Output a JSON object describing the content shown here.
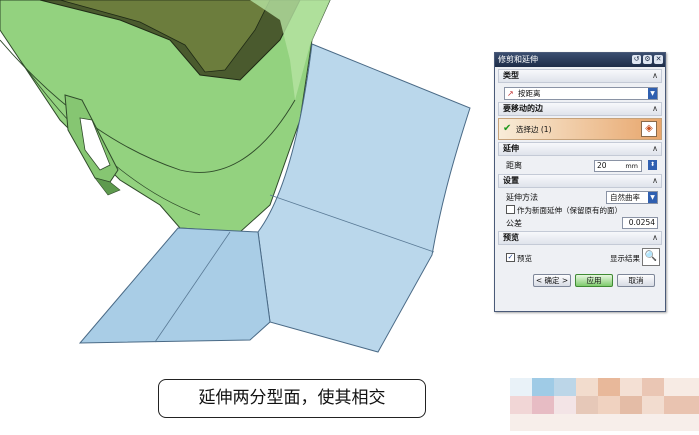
{
  "dialog": {
    "title": "修剪和延伸",
    "title_icons": [
      "rotate-icon",
      "gear-icon",
      "close-icon"
    ],
    "type_section": {
      "header": "类型",
      "selected_type": "按距离"
    },
    "edge_section": {
      "header": "要移动的边",
      "select_label": "选择边 (1)"
    },
    "extend_section": {
      "header": "延伸",
      "distance_label": "距离",
      "distance_value": "20",
      "unit": "mm"
    },
    "settings_section": {
      "header": "设置",
      "method_label": "延伸方法",
      "method_value": "自然曲率",
      "new_face_label": "作为新面延伸（保留原有的面）",
      "new_face_checked": false,
      "tolerance_label": "公差",
      "tolerance_value": "0.0254"
    },
    "preview_section": {
      "header": "预览",
      "preview_label": "预览",
      "preview_checked": true,
      "show_result_label": "显示结果"
    },
    "buttons": {
      "ok": "< 确定 >",
      "apply": "应用",
      "cancel": "取消"
    }
  },
  "caption": "延伸两分型面，使其相交",
  "colors": {
    "part_green": "#8fd07a",
    "surface_blue": "#b8d6ea",
    "surface_blue_dark": "#9cc2de",
    "titlebar": "#1e2d48"
  }
}
